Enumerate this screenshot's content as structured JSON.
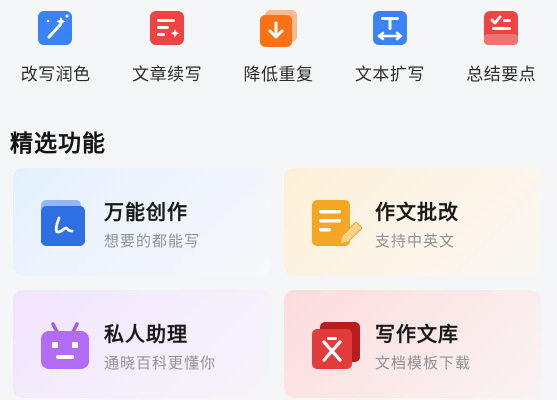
{
  "tools": [
    {
      "label": "改写润色",
      "icon": "magic-wand-icon",
      "color": "#3b82f6"
    },
    {
      "label": "文章续写",
      "icon": "continue-writing-icon",
      "color": "#ef4444"
    },
    {
      "label": "降低重复",
      "icon": "reduce-duplicate-icon",
      "color": "#f97316"
    },
    {
      "label": "文本扩写",
      "icon": "text-expand-icon",
      "color": "#3b82f6"
    },
    {
      "label": "总结要点",
      "icon": "summary-icon",
      "color": "#ef4444"
    }
  ],
  "section": {
    "title": "精选功能"
  },
  "cards": [
    {
      "title": "万能创作",
      "subtitle": "想要的都能写",
      "icon": "universal-writing-icon",
      "color": "#2f6fe4"
    },
    {
      "title": "作文批改",
      "subtitle": "支持中英文",
      "icon": "essay-correction-icon",
      "color": "#f5a623"
    },
    {
      "title": "私人助理",
      "subtitle": "通晓百科更懂你",
      "icon": "robot-assistant-icon",
      "color": "#a855f7"
    },
    {
      "title": "写作文库",
      "subtitle": "文档模板下载",
      "icon": "writing-library-icon",
      "color": "#e23b3b"
    }
  ]
}
